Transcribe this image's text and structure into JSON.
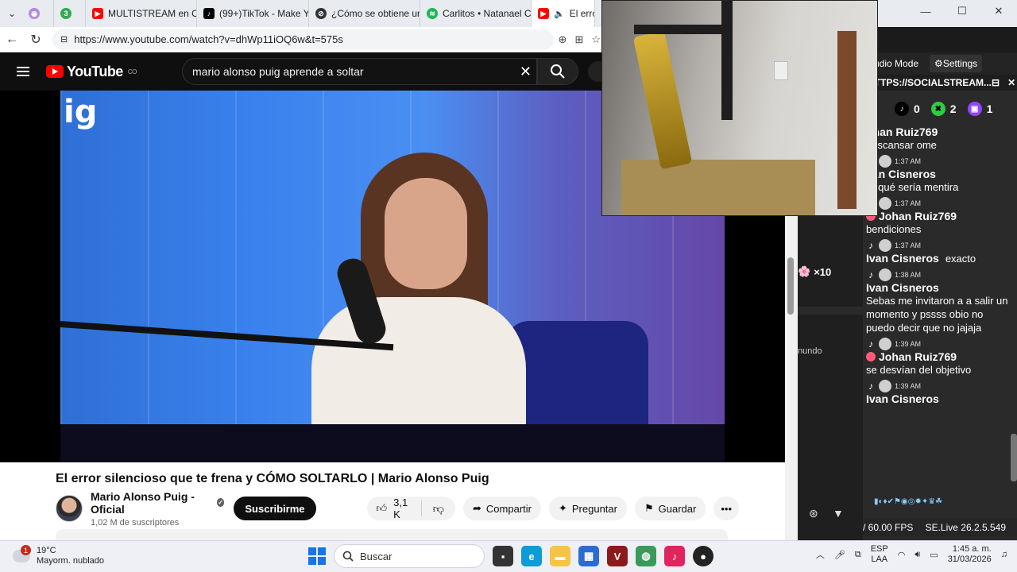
{
  "browser": {
    "tabs": [
      {
        "label": "",
        "favicon": "camera-icon",
        "color": "#b48ad9"
      },
      {
        "label": "3",
        "favicon": "notes-icon",
        "color": "#34a853"
      },
      {
        "label": "MULTISTREAM en OB",
        "favicon": "youtube-icon",
        "color": "#ff0000"
      },
      {
        "label": "(99+)TikTok - Make Y",
        "favicon": "tiktok-icon",
        "color": "#000000"
      },
      {
        "label": "¿Cómo se obtiene un",
        "favicon": "globe-icon",
        "color": "#333333"
      },
      {
        "label": "Carlitos • Natanael C",
        "favicon": "spotify-icon",
        "color": "#1db954"
      },
      {
        "label": "El error",
        "favicon": "youtube-icon",
        "color": "#ff0000"
      }
    ],
    "url": "https://www.youtube.com/watch?v=dhWp11iOQ6w&t=575s"
  },
  "youtube": {
    "logo_text": "YouTube",
    "country": "CO",
    "search_query": "mario alonso puig aprende a soltar",
    "video_overlay_text": "ig",
    "video_title": "El error silencioso que te frena y CÓMO SOLTARLO | Mario Alonso Puig",
    "channel_name": "Mario Alonso Puig - Oficial",
    "subscribers": "1,02 M de suscriptores",
    "subscribe_label": "Suscribirme",
    "likes": "3,1 K",
    "share_label": "Compartir",
    "ask_label": "Preguntar",
    "save_label": "Guardar"
  },
  "middle_panel": {
    "gift_count": "×10",
    "partial_text": "nundo"
  },
  "chat": {
    "mode_label": "udio Mode",
    "settings_label": "Settings",
    "url_label": "HTTPS://SOCIALSTREAM...",
    "counts": {
      "tiktok": "0",
      "xbox": "2",
      "twitch": "1"
    },
    "messages": [
      {
        "time": "1:37 AM",
        "user": "ohan Ruiz769",
        "text": "descansar ome",
        "badge": false
      },
      {
        "time": "1:37 AM",
        "user": "van Cisneros",
        "text": "or qué sería mentira",
        "badge": false
      },
      {
        "time": "1:37 AM",
        "user": "Johan Ruiz769",
        "text": "bendiciones",
        "badge": true
      },
      {
        "time": "1:37 AM",
        "user": "Ivan Cisneros",
        "text": "exacto",
        "badge": false,
        "inline": true
      },
      {
        "time": "1:38 AM",
        "user": "Ivan Cisneros",
        "text": "Sebas me invitaron a a salir un momento y pssss obio no puedo decir que no jajaja",
        "badge": false
      },
      {
        "time": "1:39 AM",
        "user": "Johan Ruiz769",
        "text": "se desvían del objetivo",
        "badge": true
      },
      {
        "time": "1:39 AM",
        "user": "Ivan Cisneros",
        "text": "",
        "badge": false
      }
    ],
    "fps": "/ 60.00 FPS",
    "version": "SE.Live 26.2.5.549"
  },
  "taskbar": {
    "temperature": "19°C",
    "weather": "Mayorm. nublado",
    "weather_notif": "1",
    "search_placeholder": "Buscar",
    "lang_top": "ESP",
    "lang_bottom": "LAA",
    "time": "1:45 a. m.",
    "date": "31/03/2026"
  }
}
